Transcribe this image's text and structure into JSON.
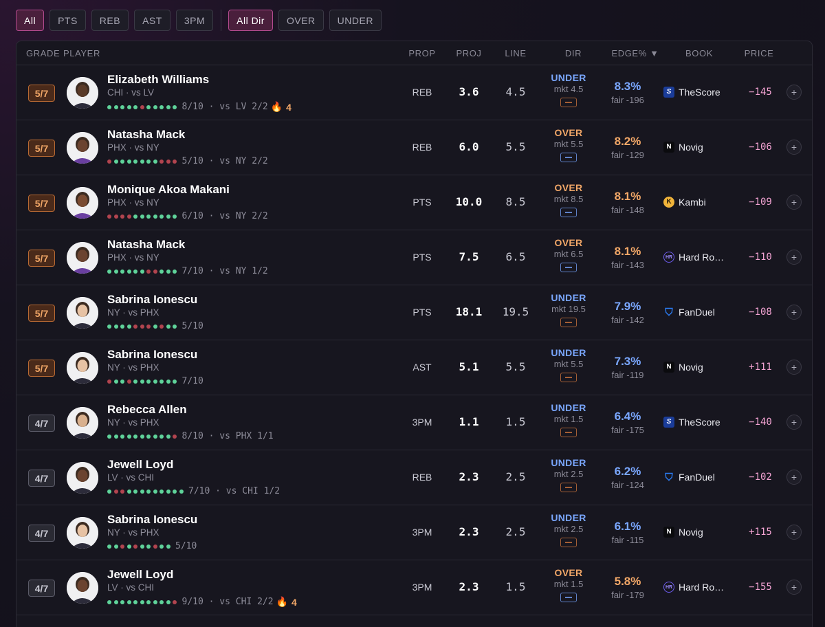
{
  "filters": {
    "stat": [
      {
        "label": "All",
        "active": true
      },
      {
        "label": "PTS",
        "active": false
      },
      {
        "label": "REB",
        "active": false
      },
      {
        "label": "AST",
        "active": false
      },
      {
        "label": "3PM",
        "active": false
      }
    ],
    "direction": [
      {
        "label": "All Dir",
        "active": true
      },
      {
        "label": "OVER",
        "active": false
      },
      {
        "label": "UNDER",
        "active": false
      }
    ]
  },
  "columns": {
    "grade": "GRADE",
    "player": "PLAYER",
    "prop": "PROP",
    "proj": "PROJ",
    "line": "LINE",
    "dir": "DIR",
    "edge": "EDGE% ▼",
    "book": "BOOK",
    "price": "PRICE"
  },
  "colors": {
    "accent": "#b34a8e",
    "under": "#7aa7ff",
    "over": "#f3a868",
    "hit_dot": "#5fd39a",
    "miss_dot": "#b2444f",
    "price": "#f2a3d2"
  },
  "rows": [
    {
      "grade": "5/7",
      "grade_tier": "orange",
      "player": "Elizabeth Williams",
      "team": "CHI · vs LV",
      "dots": "gggggrggggg",
      "form": "8/10 · vs LV 2/2",
      "streak": "4",
      "prop": "REB",
      "proj": "3.6",
      "line": "4.5",
      "dir": "UNDER",
      "mkt": "mkt 4.5",
      "edge": "8.3%",
      "fair": "fair -196",
      "book": "TheScore",
      "book_icon": "thescore-icon",
      "price": "−145"
    },
    {
      "grade": "5/7",
      "grade_tier": "orange",
      "player": "Natasha Mack",
      "team": "PHX · vs NY",
      "dots": "rgggggggrrr",
      "form": "5/10 · vs NY 2/2",
      "streak": "",
      "prop": "REB",
      "proj": "6.0",
      "line": "5.5",
      "dir": "OVER",
      "mkt": "mkt 5.5",
      "edge": "8.2%",
      "fair": "fair -129",
      "book": "Novig",
      "book_icon": "novig-icon",
      "price": "−106"
    },
    {
      "grade": "5/7",
      "grade_tier": "orange",
      "player": "Monique Akoa Makani",
      "team": "PHX · vs NY",
      "dots": "rrrrggggggg",
      "form": "6/10 · vs NY 2/2",
      "streak": "",
      "prop": "PTS",
      "proj": "10.0",
      "line": "8.5",
      "dir": "OVER",
      "mkt": "mkt 8.5",
      "edge": "8.1%",
      "fair": "fair -148",
      "book": "Kambi",
      "book_icon": "kambi-icon",
      "price": "−109"
    },
    {
      "grade": "5/7",
      "grade_tier": "orange",
      "player": "Natasha Mack",
      "team": "PHX · vs NY",
      "dots": "ggggggrrggg",
      "form": "7/10 · vs NY 1/2",
      "streak": "",
      "prop": "PTS",
      "proj": "7.5",
      "line": "6.5",
      "dir": "OVER",
      "mkt": "mkt 6.5",
      "edge": "8.1%",
      "fair": "fair -143",
      "book": "Hard Ro…",
      "book_icon": "hard-rock-icon",
      "price": "−110"
    },
    {
      "grade": "5/7",
      "grade_tier": "orange",
      "player": "Sabrina Ionescu",
      "team": "NY · vs PHX",
      "dots": "ggggrrrgrgg",
      "form": "5/10",
      "streak": "",
      "prop": "PTS",
      "proj": "18.1",
      "line": "19.5",
      "dir": "UNDER",
      "mkt": "mkt 19.5",
      "edge": "7.9%",
      "fair": "fair -142",
      "book": "FanDuel",
      "book_icon": "fanduel-icon",
      "price": "−108"
    },
    {
      "grade": "5/7",
      "grade_tier": "orange",
      "player": "Sabrina Ionescu",
      "team": "NY · vs PHX",
      "dots": "rggrggggggg",
      "form": "7/10",
      "streak": "",
      "prop": "AST",
      "proj": "5.1",
      "line": "5.5",
      "dir": "UNDER",
      "mkt": "mkt 5.5",
      "edge": "7.3%",
      "fair": "fair -119",
      "book": "Novig",
      "book_icon": "novig-icon",
      "price": "+111"
    },
    {
      "grade": "4/7",
      "grade_tier": "gray",
      "player": "Rebecca Allen",
      "team": "NY · vs PHX",
      "dots": "ggggggggggr",
      "form": "8/10 · vs PHX 1/1",
      "streak": "",
      "prop": "3PM",
      "proj": "1.1",
      "line": "1.5",
      "dir": "UNDER",
      "mkt": "mkt 1.5",
      "edge": "6.4%",
      "fair": "fair -175",
      "book": "TheScore",
      "book_icon": "thescore-icon",
      "price": "−140"
    },
    {
      "grade": "4/7",
      "grade_tier": "gray",
      "player": "Jewell Loyd",
      "team": "LV · vs CHI",
      "dots": "grrggggggggg",
      "form": "7/10 · vs CHI 1/2",
      "streak": "",
      "prop": "REB",
      "proj": "2.3",
      "line": "2.5",
      "dir": "UNDER",
      "mkt": "mkt 2.5",
      "edge": "6.2%",
      "fair": "fair -124",
      "book": "FanDuel",
      "book_icon": "fanduel-icon",
      "price": "−102"
    },
    {
      "grade": "4/7",
      "grade_tier": "gray",
      "player": "Sabrina Ionescu",
      "team": "NY · vs PHX",
      "dots": "ggrgrggrgg",
      "form": "5/10",
      "streak": "",
      "prop": "3PM",
      "proj": "2.3",
      "line": "2.5",
      "dir": "UNDER",
      "mkt": "mkt 2.5",
      "edge": "6.1%",
      "fair": "fair -115",
      "book": "Novig",
      "book_icon": "novig-icon",
      "price": "+115"
    },
    {
      "grade": "4/7",
      "grade_tier": "gray",
      "player": "Jewell Loyd",
      "team": "LV · vs CHI",
      "dots": "ggggggggggr",
      "form": "9/10 · vs CHI 2/2",
      "streak": "4",
      "prop": "3PM",
      "proj": "2.3",
      "line": "1.5",
      "dir": "OVER",
      "mkt": "mkt 1.5",
      "edge": "5.8%",
      "fair": "fair -179",
      "book": "Hard Ro…",
      "book_icon": "hard-rock-icon",
      "price": "−155"
    }
  ]
}
